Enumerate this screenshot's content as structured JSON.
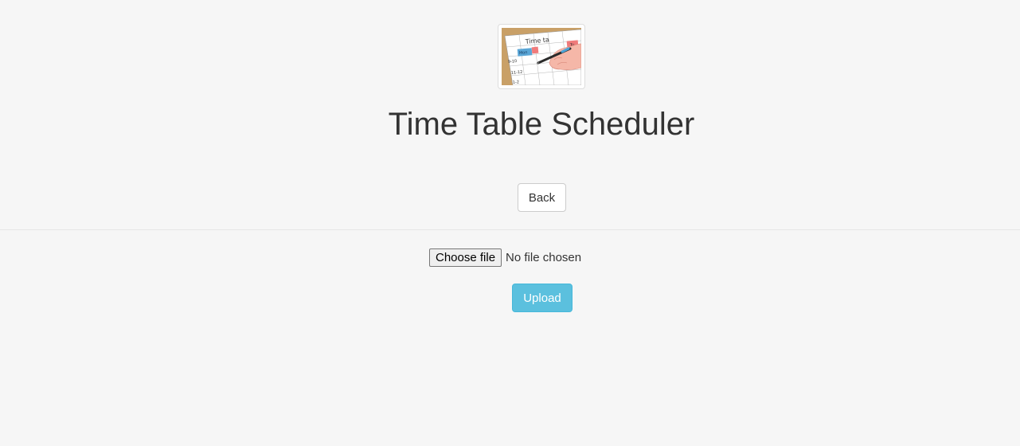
{
  "header": {
    "logo_icon": "timetable-illustration-icon",
    "logo_text": {
      "heading": "Time ta",
      "day_mon": "Mon",
      "day_tu": "Tu",
      "slot_1": "9-10",
      "slot_2": "11-12",
      "slot_3": "1-2"
    },
    "title": "Time Table Scheduler"
  },
  "nav": {
    "back_label": "Back"
  },
  "upload_form": {
    "choose_file_label": "Choose file",
    "file_status": "No file chosen",
    "upload_label": "Upload"
  },
  "colors": {
    "background": "#f6f6f6",
    "upload_button": "#5bc0de",
    "text": "#333333"
  }
}
